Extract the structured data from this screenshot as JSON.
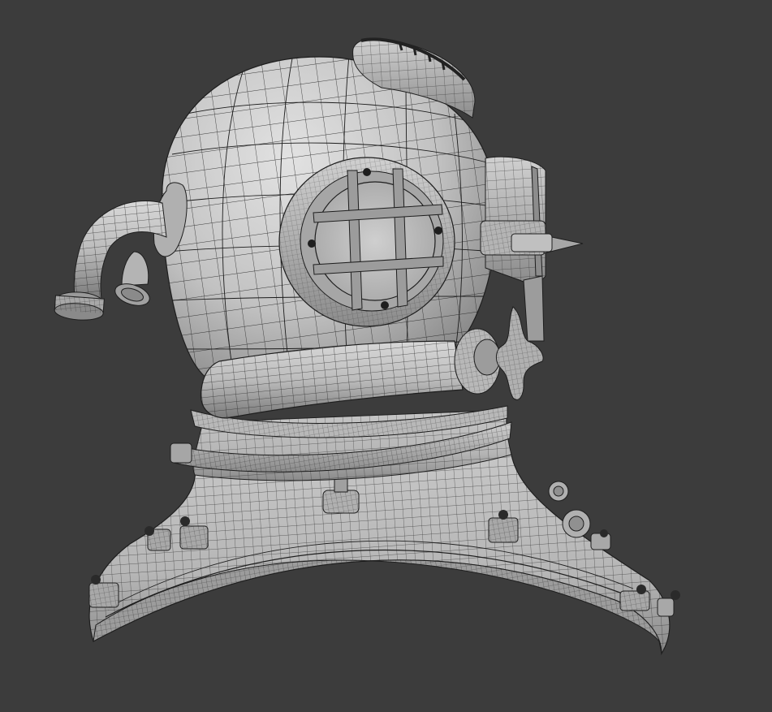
{
  "viewport": {
    "background_color": "#3c3c3c",
    "shading": "gray-clay-with-wireframe-overlay",
    "wire_color": "#1f1f1f",
    "surface_light": "#d4d4d4",
    "surface_mid": "#b4b4b4",
    "surface_dark": "#7c7c7c",
    "subject": "diving-helmet-3d-model"
  }
}
